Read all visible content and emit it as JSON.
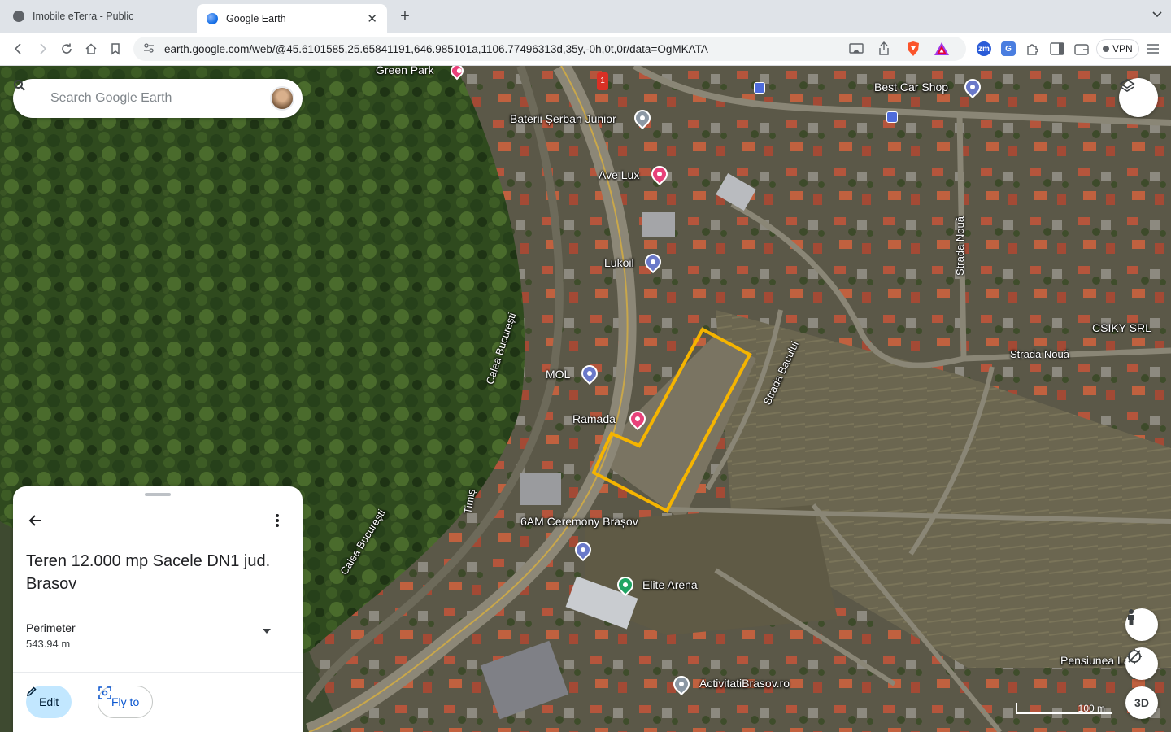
{
  "browser": {
    "tabs": [
      {
        "title": "Imobile eTerra - Public"
      },
      {
        "title": "Google Earth"
      }
    ],
    "close_glyph": "✕",
    "new_tab_glyph": "+",
    "url": "earth.google.com/web/@45.6101585,25.65841191,646.985101a,1106.77496313d,35y,-0h,0t,0r/data=OgMKATA",
    "vpn_label": "VPN",
    "extension_icons": [
      "zoom-icon",
      "translate-icon",
      "puzzle-icon",
      "sidebar-icon",
      "wallet-icon"
    ]
  },
  "search": {
    "placeholder": "Search Google Earth",
    "icon": "search-icon"
  },
  "map": {
    "places": [
      {
        "name": "Green Park"
      },
      {
        "name": "Baterii Șerban Junior"
      },
      {
        "name": "Ave Lux"
      },
      {
        "name": "Lukoil"
      },
      {
        "name": "MOL"
      },
      {
        "name": "Ramada"
      },
      {
        "name": "6AM Ceremony Brașov"
      },
      {
        "name": "Elite Arena"
      },
      {
        "name": "Best Car Shop"
      },
      {
        "name": "CSIKY SRL"
      },
      {
        "name": "Pensiunea La Lu"
      },
      {
        "name": "ActivitatiBrasov.ro"
      }
    ],
    "roads": [
      {
        "name": "Calea București"
      },
      {
        "name": "Calea București"
      },
      {
        "name": "Timiș"
      },
      {
        "name": "Strada Nouă"
      },
      {
        "name": "Strada Nouă"
      },
      {
        "name": "Strada Bacului"
      }
    ],
    "road_marker": "1",
    "scale_label": "100 m",
    "threed_label": "3D",
    "polygon_color": "#f5b400"
  },
  "panel": {
    "title": "Teren 12.000 mp Sacele DN1 jud. Brasov",
    "measure_label": "Perimeter",
    "measure_value": "543.94 m",
    "edit_label": "Edit",
    "fly_label": "Fly to"
  }
}
